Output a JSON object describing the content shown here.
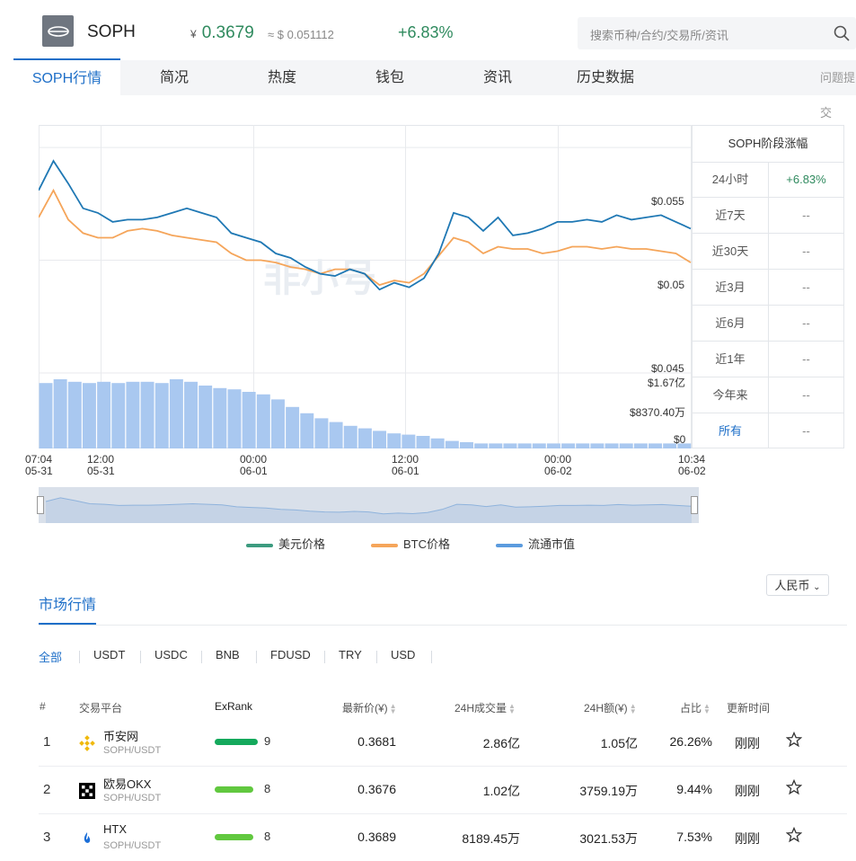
{
  "header": {
    "coin": "SOPH",
    "cny_symbol": "¥",
    "price_cny": "0.3679",
    "price_usd": "≈ $ 0.051112",
    "change": "+6.83%",
    "search_placeholder": "搜索币种/合约/交易所/资讯"
  },
  "tabs": [
    "SOPH行情",
    "简况",
    "热度",
    "钱包",
    "资讯",
    "历史数据"
  ],
  "tab_report": "问题提交",
  "chart_data": {
    "type": "line",
    "watermark": "非小号",
    "y_ticks": [
      "$0.055",
      "$0.05",
      "$0.045"
    ],
    "ylim": [
      0.045,
      0.056
    ],
    "vol_ticks": [
      "$1.67亿",
      "$8370.40万",
      "$0"
    ],
    "x_ticks": [
      {
        "time": "07:04",
        "date": "05-31"
      },
      {
        "time": "12:00",
        "date": "05-31"
      },
      {
        "time": "00:00",
        "date": "06-01"
      },
      {
        "time": "12:00",
        "date": "06-01"
      },
      {
        "time": "00:00",
        "date": "06-02"
      },
      {
        "time": "10:34",
        "date": "06-02"
      }
    ],
    "series": [
      {
        "name": "美元价格",
        "color": "#1f78b4",
        "values": [
          0.0531,
          0.0544,
          0.0534,
          0.0523,
          0.0521,
          0.0517,
          0.0518,
          0.0518,
          0.0519,
          0.0521,
          0.0523,
          0.0521,
          0.0519,
          0.0512,
          0.051,
          0.0508,
          0.0503,
          0.0501,
          0.0497,
          0.0494,
          0.0493,
          0.0496,
          0.0494,
          0.0487,
          0.049,
          0.0488,
          0.0492,
          0.0503,
          0.0521,
          0.0519,
          0.0513,
          0.0519,
          0.0511,
          0.0512,
          0.0514,
          0.0517,
          0.0517,
          0.0518,
          0.0517,
          0.052,
          0.0518,
          0.0519,
          0.052,
          0.0517,
          0.0514
        ]
      },
      {
        "name": "BTC价格",
        "color": "#f5a55a",
        "values": [
          0.0519,
          0.0531,
          0.0518,
          0.0512,
          0.051,
          0.051,
          0.0513,
          0.0514,
          0.0513,
          0.0511,
          0.051,
          0.0509,
          0.0508,
          0.0503,
          0.05,
          0.05,
          0.0499,
          0.0497,
          0.0496,
          0.0494,
          0.0496,
          0.0496,
          0.0494,
          0.0489,
          0.0491,
          0.049,
          0.0494,
          0.0502,
          0.051,
          0.0508,
          0.0503,
          0.0506,
          0.0505,
          0.0505,
          0.0503,
          0.0504,
          0.0506,
          0.0506,
          0.0505,
          0.0506,
          0.0505,
          0.0505,
          0.0504,
          0.0503,
          0.0499
        ]
      }
    ],
    "volume": {
      "name": "流通市值",
      "color": "#5b9bde",
      "values": [
        0.52,
        0.55,
        0.53,
        0.52,
        0.53,
        0.52,
        0.53,
        0.53,
        0.52,
        0.55,
        0.53,
        0.5,
        0.48,
        0.47,
        0.45,
        0.43,
        0.39,
        0.33,
        0.28,
        0.24,
        0.21,
        0.18,
        0.16,
        0.14,
        0.12,
        0.11,
        0.1,
        0.08,
        0.06,
        0.05,
        0.04,
        0.04,
        0.04,
        0.04,
        0.04,
        0.04,
        0.04,
        0.04,
        0.04,
        0.04,
        0.04,
        0.04,
        0.04,
        0.04,
        0.04
      ]
    }
  },
  "stats": {
    "title": "SOPH阶段涨幅",
    "rows": [
      {
        "k": "24小时",
        "v": "+6.83%"
      },
      {
        "k": "近7天",
        "v": "--"
      },
      {
        "k": "近30天",
        "v": "--"
      },
      {
        "k": "近3月",
        "v": "--"
      },
      {
        "k": "近6月",
        "v": "--"
      },
      {
        "k": "近1年",
        "v": "--"
      },
      {
        "k": "今年来",
        "v": "--"
      },
      {
        "k": "所有",
        "v": "--"
      }
    ]
  },
  "legend": [
    "美元价格",
    "BTC价格",
    "流通市值"
  ],
  "legend_colors": [
    "#3c9b7f",
    "#f5a55a",
    "#5b9bde"
  ],
  "market": {
    "title": "市场行情",
    "currency": "人民币",
    "filters": [
      "全部",
      "USDT",
      "USDC",
      "BNB",
      "FDUSD",
      "TRY",
      "USD"
    ],
    "columns": [
      "#",
      "交易平台",
      "ExRank",
      "最新价(¥)",
      "24H成交量",
      "24H额(¥)",
      "占比",
      "更新时间"
    ],
    "rows": [
      {
        "rank": "1",
        "exchange": "币安网",
        "pair": "SOPH/USDT",
        "score": "9",
        "score_level": 0.9,
        "bar_color": "#14a95c",
        "price": "0.3681",
        "volume": "2.86亿",
        "amount": "1.05亿",
        "share": "26.26%",
        "updated": "刚刚"
      },
      {
        "rank": "2",
        "exchange": "欧易OKX",
        "pair": "SOPH/USDT",
        "score": "8",
        "score_level": 0.8,
        "bar_color": "#61c83f",
        "price": "0.3676",
        "volume": "1.02亿",
        "amount": "3759.19万",
        "share": "9.44%",
        "updated": "刚刚"
      },
      {
        "rank": "3",
        "exchange": "HTX",
        "pair": "SOPH/USDT",
        "score": "8",
        "score_level": 0.8,
        "bar_color": "#61c83f",
        "price": "0.3689",
        "volume": "8189.45万",
        "amount": "3021.53万",
        "share": "7.53%",
        "updated": "刚刚"
      }
    ]
  }
}
